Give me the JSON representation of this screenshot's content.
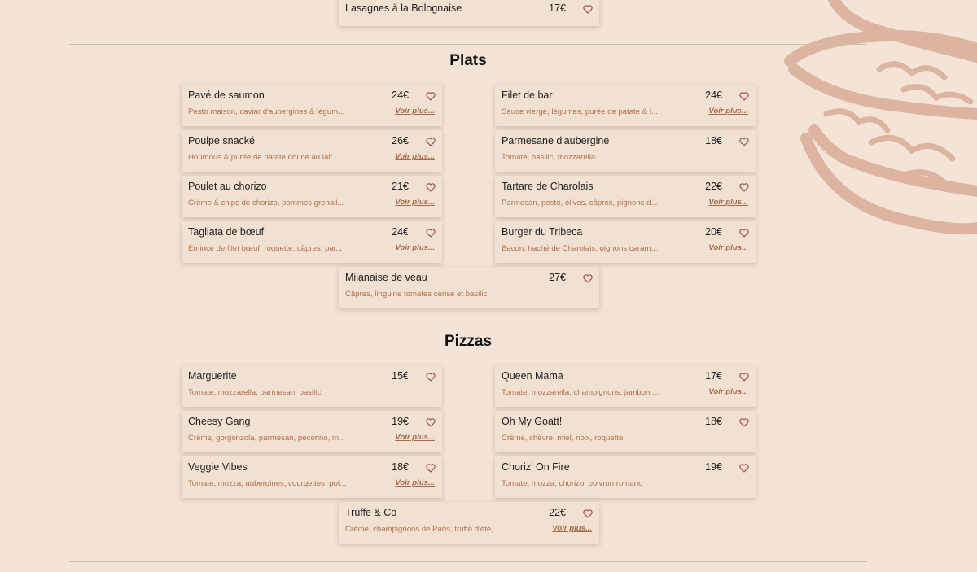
{
  "sections": {
    "top": {
      "items": [
        {
          "name": "Lasagnes à la Bolognaise",
          "price": "17€",
          "desc": "",
          "more": ""
        }
      ]
    },
    "plats": {
      "title": "Plats",
      "items": [
        {
          "name": "Pavé de saumon",
          "price": "24€",
          "desc": "Pesto maison, caviar d'aubergines & légum...",
          "more": "Voir plus..."
        },
        {
          "name": "Filet de bar",
          "price": "24€",
          "desc": "Sauce vierge, légumes, purée de patate & l...",
          "more": "Voir plus..."
        },
        {
          "name": "Poulpe snacké",
          "price": "26€",
          "desc": "Houmous & purée de patate douce au lait ...",
          "more": "Voir plus..."
        },
        {
          "name": "Parmesane d'aubergine",
          "price": "18€",
          "desc": "Tomate, basilic, mozzarella",
          "more": ""
        },
        {
          "name": "Poulet au chorizo",
          "price": "21€",
          "desc": "Crème & chips de chorizo, pommes grenail...",
          "more": "Voir plus..."
        },
        {
          "name": "Tartare de Charolais",
          "price": "22€",
          "desc": "Parmesan, pesto, olives, câpres, pignons d...",
          "more": "Voir plus..."
        },
        {
          "name": "Tagliata de bœuf",
          "price": "24€",
          "desc": "Émincé de filet bœuf, roquette, câpres, par...",
          "more": "Voir plus..."
        },
        {
          "name": "Burger du Tribeca",
          "price": "20€",
          "desc": "Bacon, haché de Charolais, oignons caram...",
          "more": "Voir plus..."
        },
        {
          "name": "Milanaise de veau",
          "price": "27€",
          "desc": "Câpres, linguine tomates cerise et basilic",
          "more": ""
        }
      ]
    },
    "pizzas": {
      "title": "Pizzas",
      "items": [
        {
          "name": "Marguerite",
          "price": "15€",
          "desc": "Tomate, mozzarella, parmesan, basilic",
          "more": ""
        },
        {
          "name": "Queen Mama",
          "price": "17€",
          "desc": "Tomate, mozzarella, champignons, jambon ...",
          "more": "Voir plus..."
        },
        {
          "name": "Cheesy Gang",
          "price": "19€",
          "desc": "Crème, gorgonzola, parmesan, pecorino, m...",
          "more": "Voir plus..."
        },
        {
          "name": "Oh My Goatt!",
          "price": "18€",
          "desc": "Crème, chèvre, miel, noix, roquette",
          "more": ""
        },
        {
          "name": "Veggie Vibes",
          "price": "18€",
          "desc": "Tomate, mozza, aubergines, courgettes, poi...",
          "more": "Voir plus..."
        },
        {
          "name": "Choriz' On Fire",
          "price": "19€",
          "desc": "Tomate, mozza, chorizo, poivron romano",
          "more": ""
        },
        {
          "name": "Truffe & Co",
          "price": "22€",
          "desc": "Crème, champignons de Paris, truffe d'été, ...",
          "more": "Voir plus..."
        }
      ]
    }
  },
  "icons": {
    "favorite": "heart-outline-icon",
    "decoration": "burger-illustration"
  },
  "colors": {
    "background": "#f3e4d7",
    "card": "#f1e1d3",
    "accent": "#b56e48",
    "heart": "#9a4f44",
    "decoration": "#dcb4a0"
  }
}
